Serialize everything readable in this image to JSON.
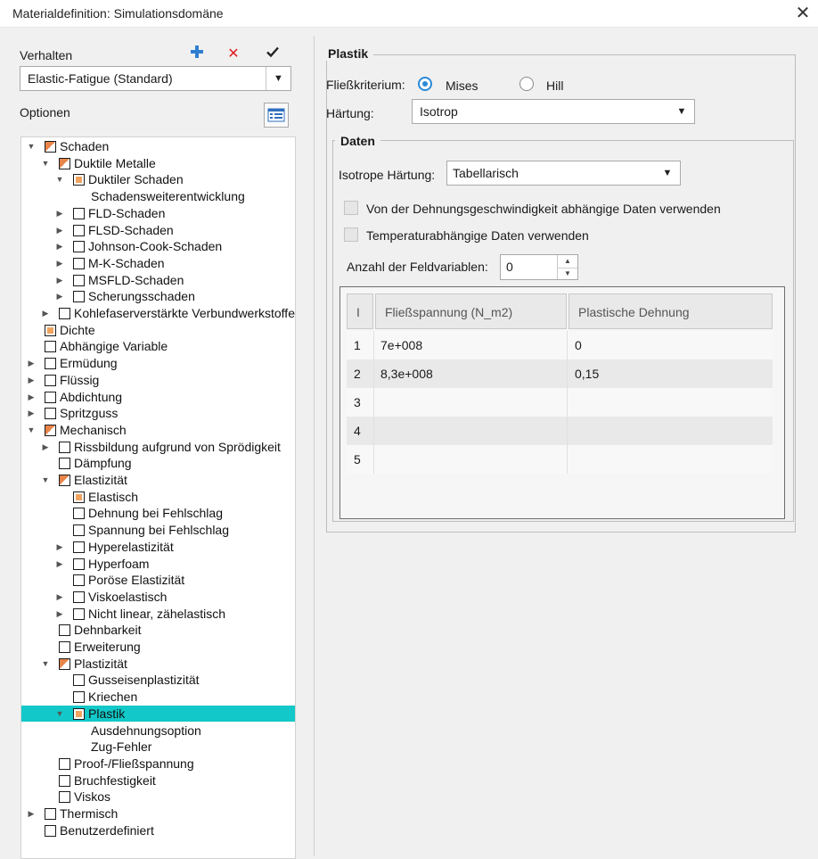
{
  "window": {
    "title": "Materialdefinition: Simulationsdomäne"
  },
  "left": {
    "verhalten_label": "Verhalten",
    "add_icon": "plus-icon",
    "delete_icon": "x-icon",
    "apply_icon": "check-icon",
    "behavior_value": "Elastic-Fatigue (Standard)",
    "options_label": "Optionen",
    "tree": [
      {
        "label": "Schaden",
        "level": 0,
        "toggle": "expanded",
        "check": "partial"
      },
      {
        "label": "Duktile Metalle",
        "level": 1,
        "toggle": "expanded",
        "check": "partial"
      },
      {
        "label": "Duktiler Schaden",
        "level": 2,
        "toggle": "expanded",
        "check": "filled"
      },
      {
        "label": "Schadensweiterentwicklung",
        "level": 3,
        "toggle": "none",
        "check": "none"
      },
      {
        "label": "FLD-Schaden",
        "level": 2,
        "toggle": "collapsed",
        "check": "empty"
      },
      {
        "label": "FLSD-Schaden",
        "level": 2,
        "toggle": "collapsed",
        "check": "empty"
      },
      {
        "label": "Johnson-Cook-Schaden",
        "level": 2,
        "toggle": "collapsed",
        "check": "empty"
      },
      {
        "label": "M-K-Schaden",
        "level": 2,
        "toggle": "collapsed",
        "check": "empty"
      },
      {
        "label": "MSFLD-Schaden",
        "level": 2,
        "toggle": "collapsed",
        "check": "empty"
      },
      {
        "label": "Scherungsschaden",
        "level": 2,
        "toggle": "collapsed",
        "check": "empty"
      },
      {
        "label": "Kohlefaserverstärkte Verbundwerkstoffe",
        "level": 1,
        "toggle": "collapsed",
        "check": "empty"
      },
      {
        "label": "Dichte",
        "level": 0,
        "toggle": "none",
        "check": "filled"
      },
      {
        "label": "Abhängige Variable",
        "level": 0,
        "toggle": "none",
        "check": "empty"
      },
      {
        "label": "Ermüdung",
        "level": 0,
        "toggle": "collapsed",
        "check": "empty"
      },
      {
        "label": "Flüssig",
        "level": 0,
        "toggle": "collapsed",
        "check": "empty"
      },
      {
        "label": "Abdichtung",
        "level": 0,
        "toggle": "collapsed",
        "check": "empty"
      },
      {
        "label": "Spritzguss",
        "level": 0,
        "toggle": "collapsed",
        "check": "empty"
      },
      {
        "label": "Mechanisch",
        "level": 0,
        "toggle": "expanded",
        "check": "partial"
      },
      {
        "label": "Rissbildung aufgrund von Sprödigkeit",
        "level": 1,
        "toggle": "collapsed",
        "check": "empty"
      },
      {
        "label": "Dämpfung",
        "level": 1,
        "toggle": "none",
        "check": "empty"
      },
      {
        "label": "Elastizität",
        "level": 1,
        "toggle": "expanded",
        "check": "partial"
      },
      {
        "label": "Elastisch",
        "level": 2,
        "toggle": "none",
        "check": "filled"
      },
      {
        "label": "Dehnung bei Fehlschlag",
        "level": 2,
        "toggle": "none",
        "check": "empty"
      },
      {
        "label": "Spannung bei Fehlschlag",
        "level": 2,
        "toggle": "none",
        "check": "empty"
      },
      {
        "label": "Hyperelastizität",
        "level": 2,
        "toggle": "collapsed",
        "check": "empty"
      },
      {
        "label": "Hyperfoam",
        "level": 2,
        "toggle": "collapsed",
        "check": "empty"
      },
      {
        "label": "Poröse Elastizität",
        "level": 2,
        "toggle": "none",
        "check": "empty"
      },
      {
        "label": "Viskoelastisch",
        "level": 2,
        "toggle": "collapsed",
        "check": "empty"
      },
      {
        "label": "Nicht linear, zähelastisch",
        "level": 2,
        "toggle": "collapsed",
        "check": "empty"
      },
      {
        "label": "Dehnbarkeit",
        "level": 1,
        "toggle": "none",
        "check": "empty"
      },
      {
        "label": "Erweiterung",
        "level": 1,
        "toggle": "none",
        "check": "empty"
      },
      {
        "label": "Plastizität",
        "level": 1,
        "toggle": "expanded",
        "check": "partial"
      },
      {
        "label": "Gusseisenplastizität",
        "level": 2,
        "toggle": "none",
        "check": "empty"
      },
      {
        "label": "Kriechen",
        "level": 2,
        "toggle": "none",
        "check": "empty"
      },
      {
        "label": "Plastik",
        "level": 2,
        "toggle": "expanded",
        "check": "filled",
        "selected": true
      },
      {
        "label": "Ausdehnungsoption",
        "level": 3,
        "toggle": "none",
        "check": "none"
      },
      {
        "label": "Zug-Fehler",
        "level": 3,
        "toggle": "none",
        "check": "none"
      },
      {
        "label": "Proof-/Fließspannung",
        "level": 1,
        "toggle": "none",
        "check": "empty"
      },
      {
        "label": "Bruchfestigkeit",
        "level": 1,
        "toggle": "none",
        "check": "empty"
      },
      {
        "label": "Viskos",
        "level": 1,
        "toggle": "none",
        "check": "empty"
      },
      {
        "label": "Thermisch",
        "level": 0,
        "toggle": "collapsed",
        "check": "empty"
      },
      {
        "label": "Benutzerdefiniert",
        "level": 0,
        "toggle": "none",
        "check": "empty"
      }
    ]
  },
  "plastik": {
    "group_title": "Plastik",
    "criterion_label": "Fließkriterium:",
    "radio_mises": "Mises",
    "radio_hill": "Hill",
    "selected_criterion": "Mises",
    "hardening_label": "Härtung:",
    "hardening_value": "Isotrop",
    "daten": {
      "group_title": "Daten",
      "iso_label": "Isotrope Härtung:",
      "iso_value": "Tabellarisch",
      "check_rate": "Von der Dehnungsgeschwindigkeit abhängige Daten verwenden",
      "check_temp": "Temperaturabhängige Daten verwenden",
      "fieldvars_label": "Anzahl der Feldvariablen:",
      "fieldvars_value": "0",
      "table": {
        "headers": [
          "I",
          "Fließspannung (N_m2)",
          "Plastische Dehnung"
        ],
        "rows": [
          [
            "1",
            "7e+008",
            "0"
          ],
          [
            "2",
            "8,3e+008",
            "0,15"
          ],
          [
            "3",
            "",
            ""
          ],
          [
            "4",
            "",
            ""
          ],
          [
            "5",
            "",
            ""
          ]
        ]
      }
    }
  }
}
